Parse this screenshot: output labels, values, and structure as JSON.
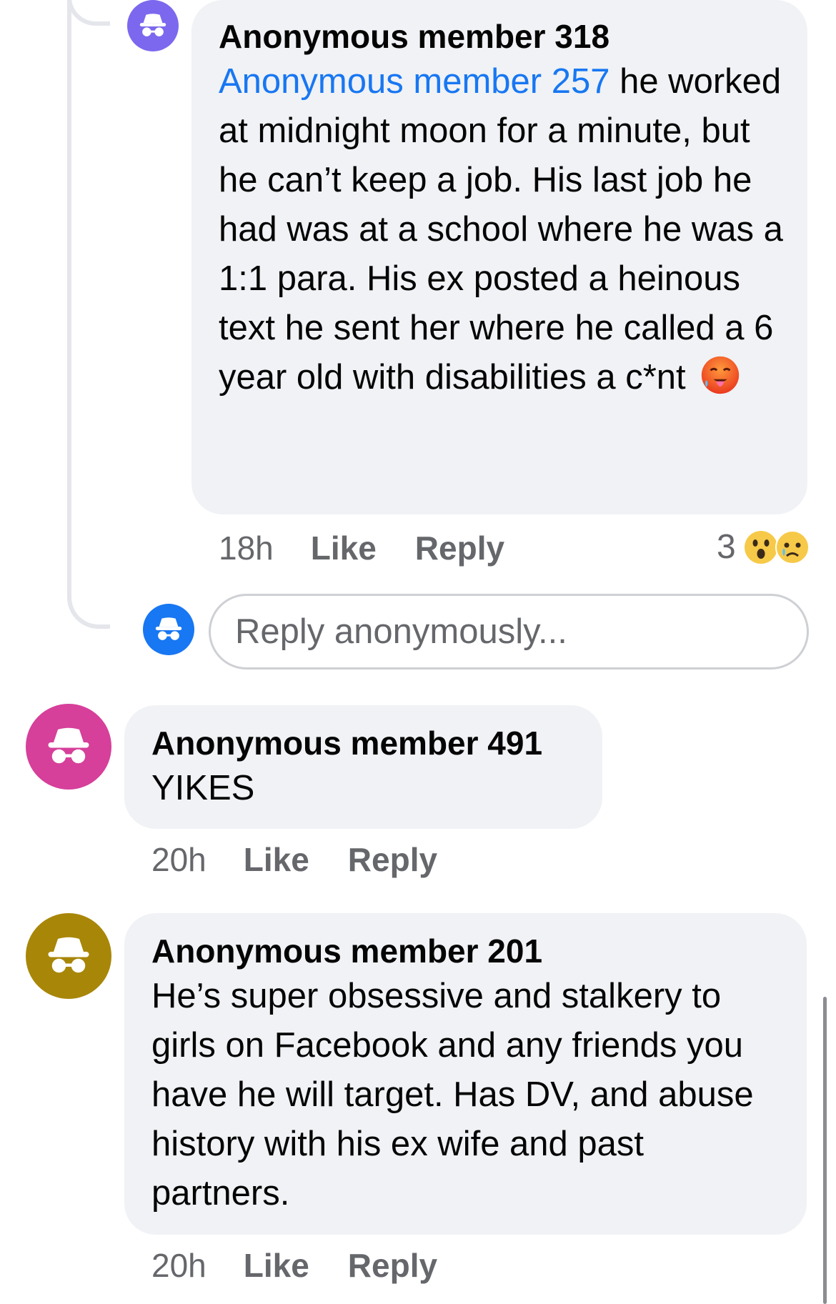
{
  "colors": {
    "bubble_bg": "#f0f2f5",
    "mention": "#1877f2",
    "meta_text": "#65676b",
    "avatar_purple": "#7b68ee",
    "avatar_blue": "#1877f2",
    "avatar_pink": "#d63f9a",
    "avatar_gold": "#a88608"
  },
  "comments": [
    {
      "author": "Anonymous member 318",
      "mention": "Anonymous member 257",
      "text": " he worked at midnight moon for a minute, but he can’t keep a job. His last job he had was at a school where he was a 1:1 para. His ex posted a heinous text he sent her where he called a 6 year old with disabilities a c*nt",
      "emoji": "hot-face-emoji",
      "time": "18h",
      "like_label": "Like",
      "reply_label": "Reply",
      "reaction_count": "3",
      "reactions": [
        "wow-reaction-icon",
        "sad-reaction-icon"
      ]
    },
    {
      "author": "Anonymous member 491",
      "text": "YIKES",
      "time": "20h",
      "like_label": "Like",
      "reply_label": "Reply"
    },
    {
      "author": "Anonymous member 201",
      "text": "He’s super obsessive and stalkery to girls on Facebook and any friends you have he will target. Has DV, and abuse history with his ex wife and past partners.",
      "time": "20h",
      "like_label": "Like",
      "reply_label": "Reply"
    }
  ],
  "reply_input": {
    "placeholder": "Reply anonymously..."
  }
}
